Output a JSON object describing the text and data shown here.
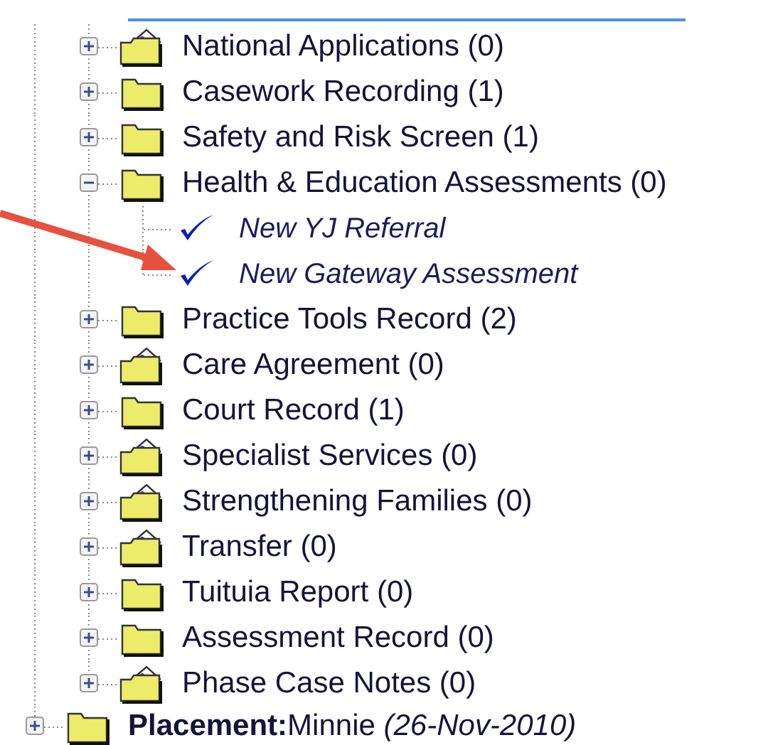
{
  "subfolders": [
    {
      "label": "National Applications (0)",
      "kind": "open-folder",
      "expanded": false
    },
    {
      "label": "Casework Recording (1)",
      "kind": "folder",
      "expanded": false
    },
    {
      "label": "Safety and Risk Screen (1)",
      "kind": "folder",
      "expanded": false
    },
    {
      "label": "Health & Education Assessments (0)",
      "kind": "folder",
      "expanded": true,
      "children": [
        {
          "label": "New YJ Referral",
          "kind": "check"
        },
        {
          "label": "New Gateway Assessment",
          "kind": "check"
        }
      ]
    },
    {
      "label": "Practice Tools Record (2)",
      "kind": "folder",
      "expanded": false
    },
    {
      "label": "Care Agreement (0)",
      "kind": "open-folder",
      "expanded": false
    },
    {
      "label": "Court Record (1)",
      "kind": "folder",
      "expanded": false
    },
    {
      "label": "Specialist Services (0)",
      "kind": "open-folder",
      "expanded": false
    },
    {
      "label": "Strengthening Families (0)",
      "kind": "open-folder",
      "expanded": false
    },
    {
      "label": "Transfer (0)",
      "kind": "open-folder",
      "expanded": false
    },
    {
      "label": "Tuituia Report (0)",
      "kind": "folder",
      "expanded": false
    },
    {
      "label": "Assessment Record (0)",
      "kind": "folder",
      "expanded": false
    },
    {
      "label": "Phase Case Notes (0)",
      "kind": "open-folder",
      "expanded": false
    }
  ],
  "root_items": [
    {
      "label": "**Placement:**Minnie *(26-Nov-2010)*",
      "kind": "folder",
      "expanded": false
    }
  ]
}
